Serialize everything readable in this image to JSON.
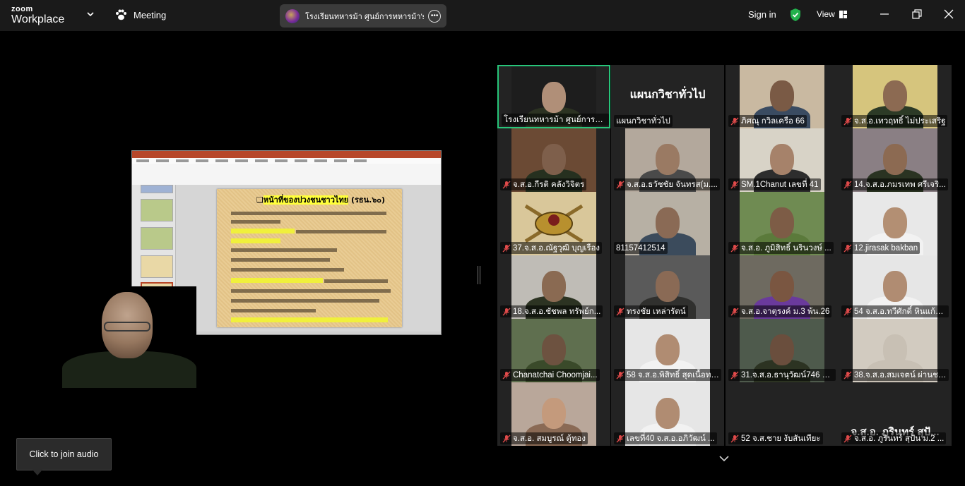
{
  "titlebar": {
    "logo_top": "zoom",
    "logo_bottom": "Workplace",
    "meeting_label": "Meeting",
    "meeting_title": "โรงเรียนทหารม้า ศูนย์การทหารม้า's sc",
    "signin_label": "Sign in",
    "view_label": "View"
  },
  "shared_slide": {
    "heading_prefix": "❑",
    "heading_highlight": "หน้าที่ของปวงชนชาวไทย",
    "heading_suffix": " (รธน.๖๐)"
  },
  "gallery": {
    "tiles": [
      {
        "label": "โรงเรียนทหารม้า ศูนย์การทหา...",
        "muted": false,
        "active": true,
        "kind": "video",
        "skin": "#b08f78",
        "shirt": "#2c3322",
        "bg": "#1d1d1d"
      },
      {
        "label": "แผนกวิชาทั่วไป",
        "muted": false,
        "active": false,
        "kind": "name",
        "center_name": "แผนกวิชาทั่วไป"
      },
      {
        "label": "ภิศณุ กวิลเครือ  66",
        "muted": true,
        "active": false,
        "kind": "video",
        "skin": "#7a5a45",
        "shirt": "#3a4b61",
        "bg": "#c9b9a1"
      },
      {
        "label": "จ.ส.อ.เทวฤทธิ์  ไม่ประเสริฐ",
        "muted": true,
        "active": false,
        "kind": "video",
        "skin": "#8c6a52",
        "shirt": "#2c3a26",
        "bg": "#d6c57d"
      },
      {
        "label": "จ.ส.อ.กีรติ คลังวิจิตร",
        "muted": true,
        "active": false,
        "kind": "video",
        "skin": "#7e5f4b",
        "shirt": "#26301f",
        "bg": "#6b4a34"
      },
      {
        "label": "จ.ส.อ.ธวัชชัย จันทรส(ม....",
        "muted": true,
        "active": false,
        "kind": "video",
        "skin": "#9a7a63",
        "shirt": "#4a4a4a",
        "bg": "#b3a89c"
      },
      {
        "label": "SM.1Chanut เลขที่ 41",
        "muted": true,
        "active": false,
        "kind": "video",
        "skin": "#a6826a",
        "shirt": "#2d2d2d",
        "bg": "#d8d3c7"
      },
      {
        "label": "14.จ.ส.อ.ภมรเทพ ศรีเจริ...",
        "muted": true,
        "active": false,
        "kind": "video",
        "skin": "#8c6a52",
        "shirt": "#2a3322",
        "bg": "#8a7f84"
      },
      {
        "label": "37.จ.ส.อ.ณัฐวุฒิ  บุญเรือง",
        "muted": true,
        "active": false,
        "kind": "emblem",
        "bg": "#d9c79a"
      },
      {
        "label": "81157412514",
        "muted": false,
        "active": false,
        "kind": "video",
        "skin": "#8a6a55",
        "shirt": "#3b4b5c",
        "bg": "#b7b0a4"
      },
      {
        "label": "จ.ส.อ. ภูมิสิทธิ์ นรินวงษ์ ...",
        "muted": true,
        "active": false,
        "kind": "video",
        "skin": "#7d5c46",
        "shirt": "#5b7a3b",
        "bg": "#6f8b52"
      },
      {
        "label": "12.jirasak bakban",
        "muted": true,
        "active": false,
        "kind": "video",
        "skin": "#b38f73",
        "shirt": "#f2f2f2",
        "bg": "#e8e8e8"
      },
      {
        "label": "18.จ.ส.อ.ชัชพล ทรัพย์ก...",
        "muted": true,
        "active": false,
        "kind": "video",
        "skin": "#8a6a52",
        "shirt": "#2c3322",
        "bg": "#bfbcb6"
      },
      {
        "label": "ทรงชัย   เหล่ารัตน์",
        "muted": true,
        "active": false,
        "kind": "video",
        "skin": "#8a6a55",
        "shirt": "#30302e",
        "bg": "#5a5a5a"
      },
      {
        "label": "จ.ส.อ.จาตุรงค์ ม.3 พ้น.26",
        "muted": true,
        "active": false,
        "kind": "video",
        "skin": "#7a5641",
        "shirt": "#6a3a9c",
        "bg": "#6e6a60"
      },
      {
        "label": "54 จ.ส.อ.ทวีศักดิ์  หินแก้ว...",
        "muted": true,
        "active": false,
        "kind": "video",
        "skin": "#b08c72",
        "shirt": "#f2f2f2",
        "bg": "#e6e6e6"
      },
      {
        "label": "Chanatchai Choomjai...",
        "muted": true,
        "active": false,
        "kind": "video",
        "skin": "#6d5240",
        "shirt": "#3a4a2a",
        "bg": "#5f6f4f"
      },
      {
        "label": "58 จ.ส.อ.พิสิทธิ์ สุดเนื้อทอง",
        "muted": true,
        "active": false,
        "kind": "video",
        "skin": "#b08c72",
        "shirt": "#f2f2f2",
        "bg": "#e6e6e6"
      },
      {
        "label": "31.จ.ส.อ.ธานุวัฒน์746 ม...",
        "muted": true,
        "active": false,
        "kind": "video",
        "skin": "#6a4e3d",
        "shirt": "#2c3322",
        "bg": "#4e5a4c"
      },
      {
        "label": "38.จ.ส.อ.สมเจตน์ ผ่านชมภู",
        "muted": true,
        "active": false,
        "kind": "video",
        "skin": "#c8c0b4",
        "shirt": "#c8c0b4",
        "bg": "#d2cbc0"
      },
      {
        "label": "จ.ส.อ. สมบูรณ์  ตู้ทอง",
        "muted": true,
        "active": false,
        "kind": "video",
        "skin": "#c49a7c",
        "shirt": "#8a6a55",
        "bg": "#b9a79a"
      },
      {
        "label": "เลขที่40 จ.ส.อ.อภิวัฒน์ ...",
        "muted": true,
        "active": false,
        "kind": "video",
        "skin": "#b08c72",
        "shirt": "#f2f2f2",
        "bg": "#e6e6e6"
      },
      {
        "label": "52 จ.ส.ชาย งับสันเทียะ",
        "muted": true,
        "active": false,
        "kind": "blank"
      },
      {
        "label": "จ.ส.อ. ภูรินทร์ สุปัน ม.2 ...",
        "muted": true,
        "active": false,
        "kind": "name",
        "center_name": "จ.ส.อ. ภูรินทร์ สุปั..."
      }
    ]
  },
  "join_audio_label": "Click to join audio"
}
